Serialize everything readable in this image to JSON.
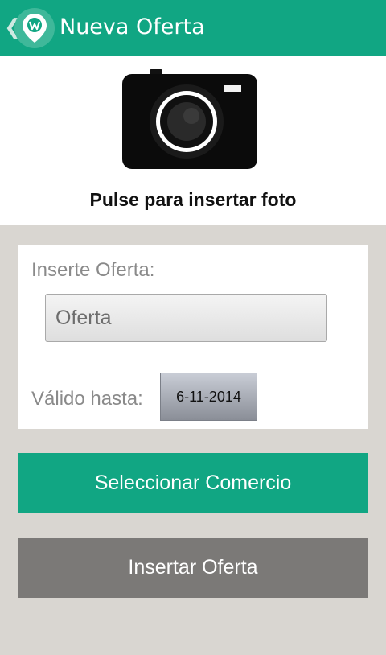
{
  "header": {
    "title": "Nueva Oferta",
    "back_glyph": "❮",
    "icons": [
      "back-chevron-icon",
      "app-logo-pin-icon"
    ]
  },
  "photo": {
    "label": "Pulse para insertar foto",
    "icon": "camera-icon"
  },
  "form": {
    "offer_label": "Inserte Oferta:",
    "offer_placeholder": "Oferta",
    "offer_value": "",
    "valid_label": "Válido hasta:",
    "valid_date": "6-11-2014"
  },
  "actions": {
    "select_store": "Seleccionar Comercio",
    "insert_offer": "Insertar Oferta"
  },
  "colors": {
    "accent": "#11a683",
    "background": "#d9d6d1",
    "secondary_button": "#7b7977"
  }
}
